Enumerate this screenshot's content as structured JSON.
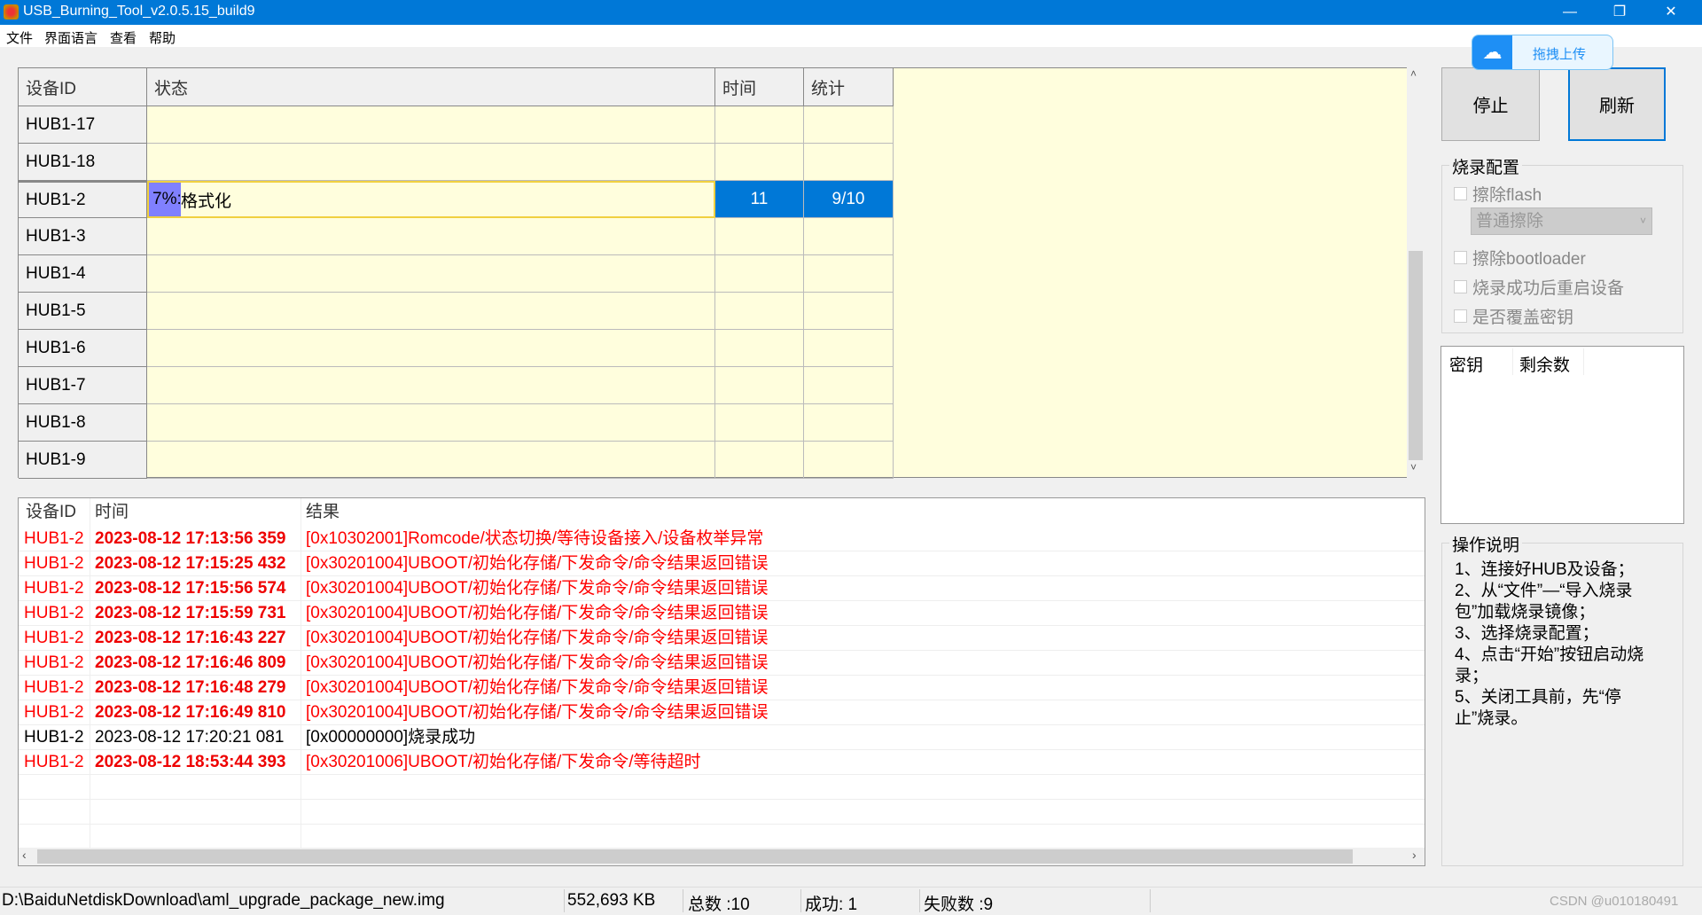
{
  "window": {
    "title": "USB_Burning_Tool_v2.0.5.15_build9"
  },
  "menu": [
    "文件",
    "界面语言",
    "查看",
    "帮助"
  ],
  "grid": {
    "headers": [
      "设备ID",
      "状态",
      "时间",
      "统计"
    ],
    "rows": [
      {
        "id": "HUB1-17",
        "status": "",
        "time": "",
        "stats": ""
      },
      {
        "id": "HUB1-18",
        "status": "",
        "time": "",
        "stats": ""
      },
      {
        "id": "HUB1-2",
        "progress_pct": 7,
        "progress_label": "7%:",
        "status": "格式化",
        "time": "11",
        "stats": "9/10"
      },
      {
        "id": "HUB1-3",
        "status": "",
        "time": "",
        "stats": ""
      },
      {
        "id": "HUB1-4",
        "status": "",
        "time": "",
        "stats": ""
      },
      {
        "id": "HUB1-5",
        "status": "",
        "time": "",
        "stats": ""
      },
      {
        "id": "HUB1-6",
        "status": "",
        "time": "",
        "stats": ""
      },
      {
        "id": "HUB1-7",
        "status": "",
        "time": "",
        "stats": ""
      },
      {
        "id": "HUB1-8",
        "status": "",
        "time": "",
        "stats": ""
      },
      {
        "id": "HUB1-9",
        "status": "",
        "time": "",
        "stats": ""
      }
    ]
  },
  "log": {
    "headers": [
      "设备ID",
      "时间",
      "结果"
    ],
    "rows": [
      {
        "id": "HUB1-2",
        "time": "2023-08-12 17:13:56 359",
        "result": "[0x10302001]Romcode/状态切换/等待设备接入/设备枚举异常",
        "error": true
      },
      {
        "id": "HUB1-2",
        "time": "2023-08-12 17:15:25 432",
        "result": "[0x30201004]UBOOT/初始化存储/下发命令/命令结果返回错误",
        "error": true
      },
      {
        "id": "HUB1-2",
        "time": "2023-08-12 17:15:56 574",
        "result": "[0x30201004]UBOOT/初始化存储/下发命令/命令结果返回错误",
        "error": true
      },
      {
        "id": "HUB1-2",
        "time": "2023-08-12 17:15:59 731",
        "result": "[0x30201004]UBOOT/初始化存储/下发命令/命令结果返回错误",
        "error": true
      },
      {
        "id": "HUB1-2",
        "time": "2023-08-12 17:16:43 227",
        "result": "[0x30201004]UBOOT/初始化存储/下发命令/命令结果返回错误",
        "error": true
      },
      {
        "id": "HUB1-2",
        "time": "2023-08-12 17:16:46 809",
        "result": "[0x30201004]UBOOT/初始化存储/下发命令/命令结果返回错误",
        "error": true
      },
      {
        "id": "HUB1-2",
        "time": "2023-08-12 17:16:48 279",
        "result": "[0x30201004]UBOOT/初始化存储/下发命令/命令结果返回错误",
        "error": true
      },
      {
        "id": "HUB1-2",
        "time": "2023-08-12 17:16:49 810",
        "result": "[0x30201004]UBOOT/初始化存储/下发命令/命令结果返回错误",
        "error": true
      },
      {
        "id": "HUB1-2",
        "time": "2023-08-12 17:20:21 081",
        "result": "[0x00000000]烧录成功",
        "error": false
      },
      {
        "id": "HUB1-2",
        "time": "2023-08-12 18:53:44 393",
        "result": "[0x30201006]UBOOT/初始化存储/下发命令/等待超时",
        "error": true
      }
    ]
  },
  "upload": {
    "label": "拖拽上传"
  },
  "buttons": {
    "stop": "停止",
    "refresh": "刷新"
  },
  "config": {
    "title": "烧录配置",
    "erase_flash": "擦除flash",
    "erase_mode": "普通擦除",
    "erase_bootloader": "擦除bootloader",
    "reboot_after": "烧录成功后重启设备",
    "overwrite_key": "是否覆盖密钥"
  },
  "keys": {
    "headers": [
      "密钥",
      "剩余数"
    ]
  },
  "help": {
    "title": "操作说明",
    "lines": [
      "1、连接好HUB及设备；",
      "2、从“文件”—“导入烧录包”加载烧录镜像；",
      "3、选择烧录配置；",
      "4、点击“开始”按钮启动烧录；",
      "5、关闭工具前，先“停止”烧录。"
    ]
  },
  "status": {
    "path": "D:\\BaiduNetdiskDownload\\aml_upgrade_package_new.img",
    "size": "552,693 KB",
    "total": "总数 :10",
    "success": "成功:  1",
    "fail": "失败数 :9",
    "watermark": "CSDN @u010180491"
  }
}
